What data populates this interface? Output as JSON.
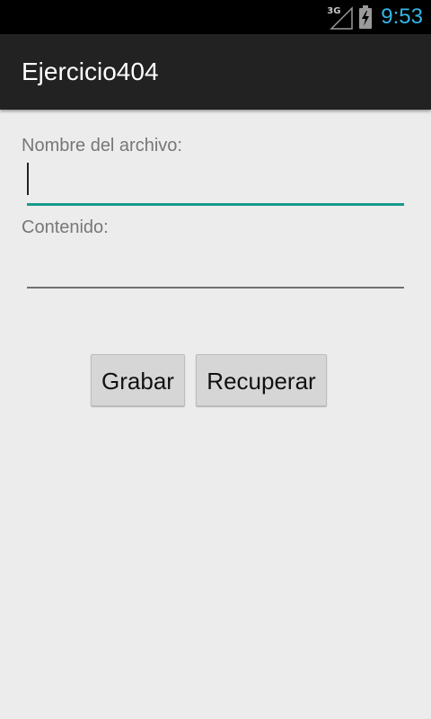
{
  "status_bar": {
    "network_label": "3G",
    "time": "9:53",
    "clock_color": "#33b5e5",
    "icons": [
      "signal-3g-icon",
      "battery-charging-icon"
    ]
  },
  "action_bar": {
    "title": "Ejercicio404"
  },
  "form": {
    "nombre_label": "Nombre del archivo:",
    "nombre_value": "",
    "contenido_label": "Contenido:",
    "contenido_value": "",
    "focus_color": "#169a8c"
  },
  "buttons": {
    "grabar": "Grabar",
    "recuperar": "Recuperar"
  }
}
